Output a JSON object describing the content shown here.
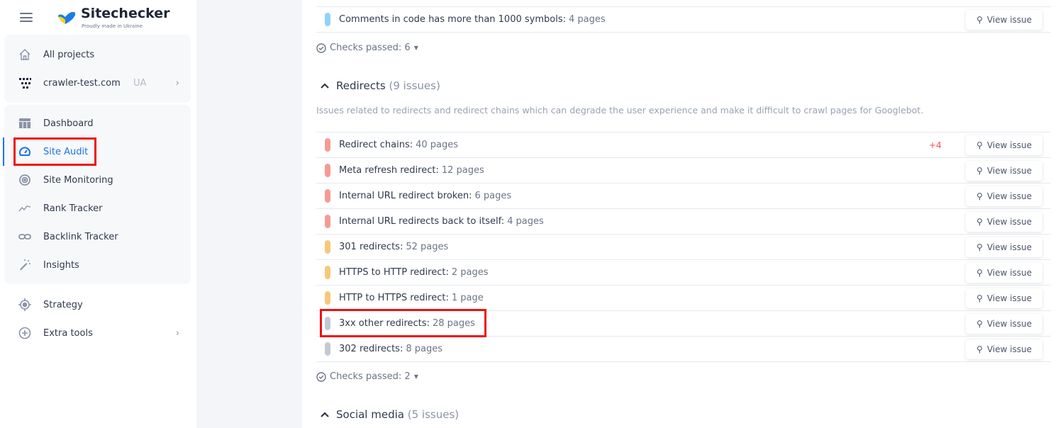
{
  "brand": {
    "name": "Sitechecker",
    "tagline": "Proudly made in Ukraine"
  },
  "sidebar": {
    "top": [
      {
        "label": "All projects",
        "icon": "home-icon"
      },
      {
        "label": "crawler-test.com",
        "badge": "UA",
        "icon": "project-grid-icon"
      }
    ],
    "nav": [
      {
        "label": "Dashboard",
        "icon": "dashboard-icon"
      },
      {
        "label": "Site Audit",
        "icon": "gauge-icon",
        "active": true
      },
      {
        "label": "Site Monitoring",
        "icon": "monitoring-icon"
      },
      {
        "label": "Rank Tracker",
        "icon": "rank-icon"
      },
      {
        "label": "Backlink Tracker",
        "icon": "link-icon"
      },
      {
        "label": "Insights",
        "icon": "magic-wand-icon"
      }
    ],
    "bottom": [
      {
        "label": "Strategy",
        "icon": "target-icon"
      },
      {
        "label": "Extra tools",
        "icon": "plus-circle-icon"
      }
    ]
  },
  "main": {
    "prev_row": {
      "name": "Comments in code has more than 1000 symbols:",
      "count": "4 pages",
      "color": "#8fd3f8"
    },
    "prev_passed": "Checks passed: 6",
    "view_label": "View issue",
    "redirects": {
      "title": "Redirects",
      "count": "(9 issues)",
      "description": "Issues related to redirects and redirect chains which can degrade the user experience and make it difficult to crawl pages for Googlebot.",
      "rows": [
        {
          "name": "Redirect chains:",
          "count": "40 pages",
          "color": "#f59b93",
          "delta": "+4"
        },
        {
          "name": "Meta refresh redirect:",
          "count": "12 pages",
          "color": "#f59b93"
        },
        {
          "name": "Internal URL redirect broken:",
          "count": "6 pages",
          "color": "#f59b93"
        },
        {
          "name": "Internal URL redirects back to itself:",
          "count": "4 pages",
          "color": "#f59b93"
        },
        {
          "name": "301 redirects:",
          "count": "52 pages",
          "color": "#f8c77a"
        },
        {
          "name": "HTTPS to HTTP redirect:",
          "count": "2 pages",
          "color": "#f8c77a"
        },
        {
          "name": "HTTP to HTTPS redirect:",
          "count": "1 page",
          "color": "#f8c77a"
        },
        {
          "name": "3xx other redirects:",
          "count": "28 pages",
          "color": "#c3c9d4"
        },
        {
          "name": "302 redirects:",
          "count": "8 pages",
          "color": "#c3c9d4"
        }
      ],
      "passed": "Checks passed: 2"
    },
    "next_section": {
      "title": "Social media",
      "count": "(5 issues)"
    }
  }
}
